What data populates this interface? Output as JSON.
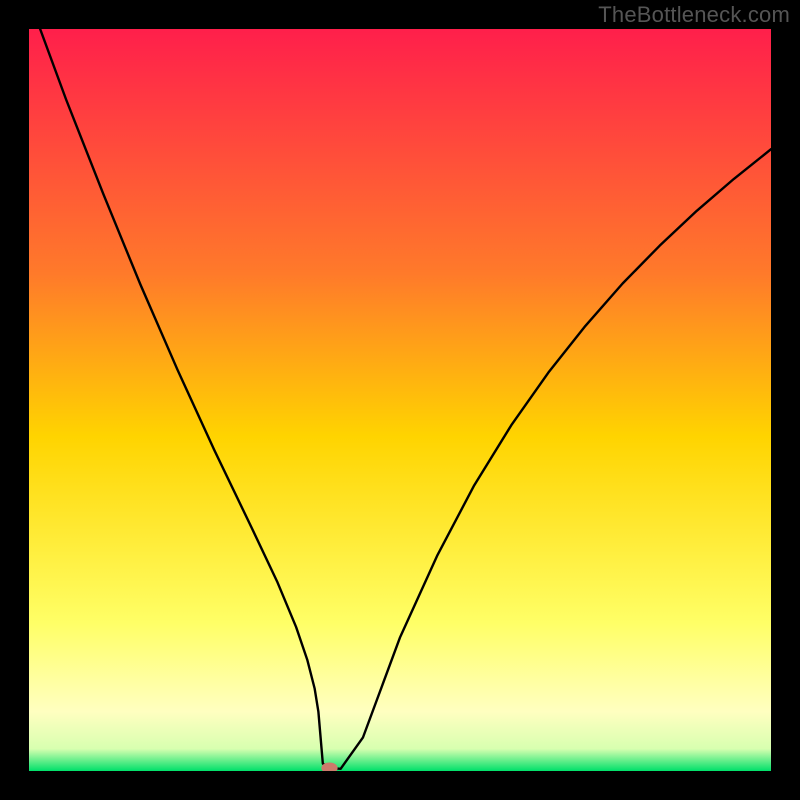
{
  "watermark": "TheBottleneck.com",
  "chart_data": {
    "type": "line",
    "title": "",
    "xlabel": "",
    "ylabel": "",
    "xlim": [
      0,
      100
    ],
    "ylim": [
      0,
      100
    ],
    "background_gradient": {
      "top": "#ff1f4b",
      "mid_upper": "#ff7a2a",
      "mid": "#ffd400",
      "mid_lower": "#ffff66",
      "band": "#ffffc0",
      "bottom": "#00e06a"
    },
    "series": [
      {
        "name": "bottleneck-curve",
        "x": [
          1.5,
          5,
          10,
          15,
          20,
          25,
          30,
          33.5,
          36,
          37.5,
          38.5,
          39,
          39.3,
          39.6,
          40.5,
          42,
          45,
          50,
          55,
          60,
          65,
          70,
          75,
          80,
          85,
          90,
          95,
          100
        ],
        "y": [
          100,
          90.5,
          77.8,
          65.6,
          54.1,
          43.2,
          32.8,
          25.4,
          19.4,
          15.0,
          11.1,
          8.0,
          4.5,
          1.0,
          0.4,
          0.3,
          4.5,
          18.0,
          29.0,
          38.5,
          46.6,
          53.7,
          60.0,
          65.7,
          70.8,
          75.5,
          79.8,
          83.8
        ]
      }
    ],
    "marker": {
      "name": "bottleneck-point",
      "x": 40.5,
      "y": 0.4,
      "rx": 1.1,
      "ry": 0.75,
      "color": "#cc7a6b"
    }
  }
}
